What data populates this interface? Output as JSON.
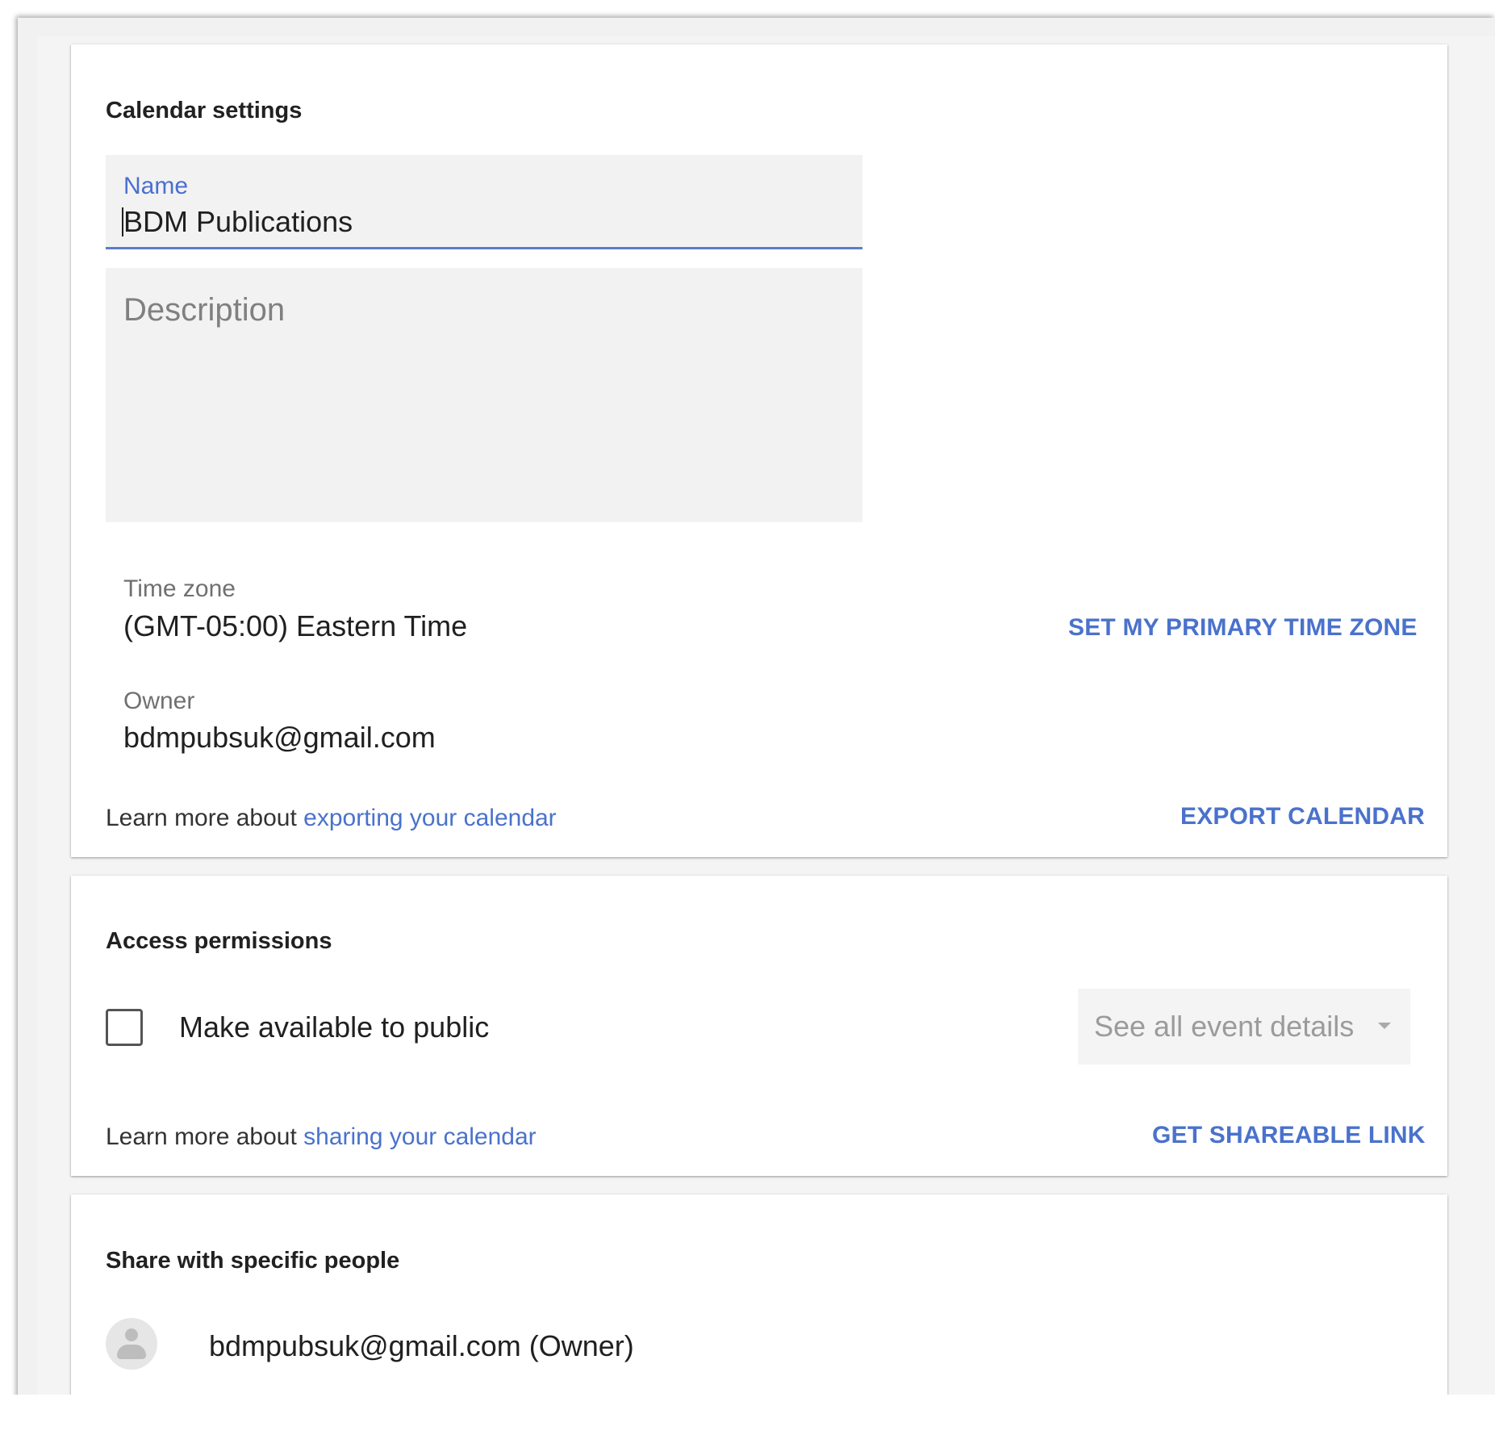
{
  "calendar_settings": {
    "title": "Calendar settings",
    "name_label": "Name",
    "name_value": "BDM Publications",
    "description_placeholder": "Description",
    "time_zone_label": "Time zone",
    "time_zone_value": "(GMT-05:00) Eastern Time",
    "set_primary_tz_button": "SET MY PRIMARY TIME ZONE",
    "owner_label": "Owner",
    "owner_value": "bdmpubsuk@gmail.com",
    "learn_prefix": "Learn more about ",
    "learn_link": "exporting your calendar",
    "export_button": "EXPORT CALENDAR"
  },
  "access_permissions": {
    "title": "Access permissions",
    "public_checkbox_label": "Make available to public",
    "public_checked": false,
    "detail_select_value": "See all event details",
    "learn_prefix": "Learn more about ",
    "learn_link": "sharing your calendar",
    "shareable_link_button": "GET SHAREABLE LINK"
  },
  "share_specific": {
    "title": "Share with specific people",
    "people": [
      {
        "label": "bdmpubsuk@gmail.com (Owner)"
      }
    ]
  },
  "colors": {
    "accent": "#4a72cc",
    "field_background": "#f3f2f3",
    "focus_underline": "#5b7fc7"
  }
}
